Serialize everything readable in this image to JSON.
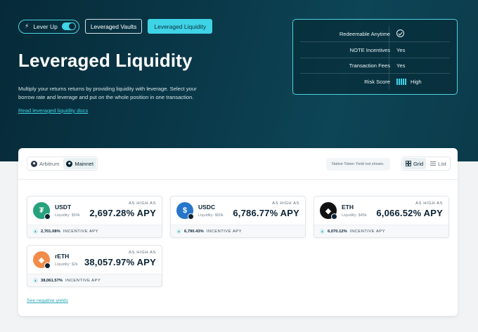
{
  "nav": {
    "lever_up": "Lever Up",
    "leveraged_vaults": "Leveraged Vaults",
    "leveraged_liquidity": "Leveraged Liquidity"
  },
  "hero": {
    "title": "Leveraged Liquidity",
    "description": "Multiply your returns returns by providing liquidity with leverage. Select your borrow rate and leverage and put on the whole position in one transaction.",
    "docs_link": "Read leveraged liquidity docs"
  },
  "info": {
    "rows": [
      {
        "label": "Redeemable Anytime",
        "value": ""
      },
      {
        "label": "NOTE Incentives",
        "value": "Yes"
      },
      {
        "label": "Transaction Fees",
        "value": "Yes"
      },
      {
        "label": "Risk Score",
        "value": "High"
      }
    ]
  },
  "panel": {
    "networks": [
      "Arbitrum",
      "Mainnet"
    ],
    "note": "Native Token Yield not shown.",
    "views": [
      "Grid",
      "List"
    ],
    "as_high_as": "AS HIGH AS",
    "incentive_label": "INCENTIVE APY",
    "negative_link": "See negative yields",
    "cards": [
      {
        "symbol": "USDT",
        "liquidity": "Liquidity: $50k",
        "apy": "2,697.28% APY",
        "incentive": "2,701.08%",
        "color": "#26a17b"
      },
      {
        "symbol": "USDC",
        "liquidity": "Liquidity: $50k",
        "apy": "6,786.77% APY",
        "incentive": "6,790.43%",
        "color": "#2775ca"
      },
      {
        "symbol": "ETH",
        "liquidity": "Liquidity: $45k",
        "apy": "6,066.52% APY",
        "incentive": "6,070.12%",
        "color": "#111111"
      },
      {
        "symbol": "rETH",
        "liquidity": "Liquidity: $2k",
        "apy": "38,057.97% APY",
        "incentive": "38,061.57%",
        "color": "#f28c4a"
      }
    ]
  },
  "colors": {
    "accent": "#3fd3e6",
    "hero_bg": "#0a3a4b"
  }
}
